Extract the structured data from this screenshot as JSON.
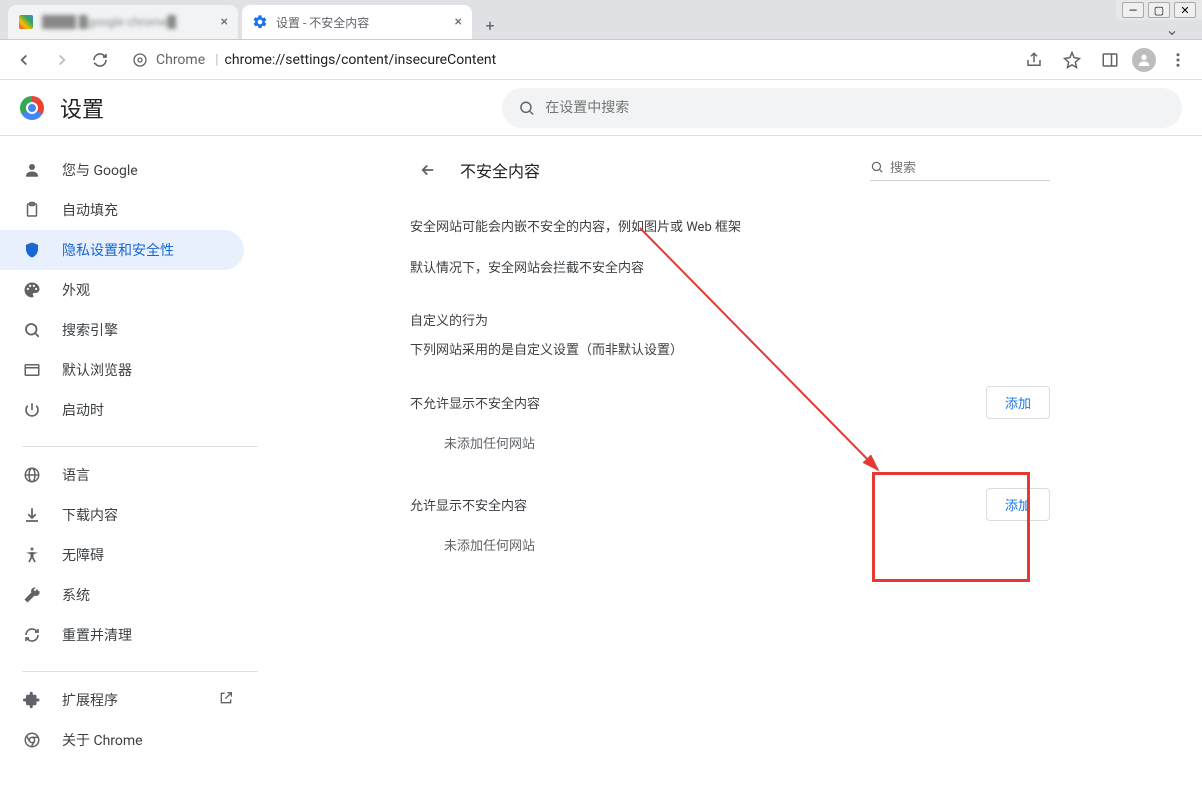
{
  "window": {
    "title_bar_inactive_tab": "████ █google chrome█"
  },
  "tabs": {
    "inactive": {
      "title": "████ █google chrome█"
    },
    "active": {
      "title": "设置 - 不安全内容"
    }
  },
  "toolbar": {
    "chrome_label": "Chrome",
    "url": "chrome://settings/content/insecureContent"
  },
  "settings_header": {
    "title": "设置",
    "search_placeholder": "在设置中搜索"
  },
  "sidebar": {
    "group1": [
      {
        "icon": "person",
        "label": "您与 Google"
      },
      {
        "icon": "clipboard",
        "label": "自动填充"
      },
      {
        "icon": "shield",
        "label": "隐私设置和安全性",
        "active": true
      },
      {
        "icon": "palette",
        "label": "外观"
      },
      {
        "icon": "search",
        "label": "搜索引擎"
      },
      {
        "icon": "browser",
        "label": "默认浏览器"
      },
      {
        "icon": "power",
        "label": "启动时"
      }
    ],
    "group2": [
      {
        "icon": "globe",
        "label": "语言"
      },
      {
        "icon": "download",
        "label": "下载内容"
      },
      {
        "icon": "accessibility",
        "label": "无障碍"
      },
      {
        "icon": "wrench",
        "label": "系统"
      },
      {
        "icon": "refresh",
        "label": "重置并清理"
      }
    ],
    "group3": [
      {
        "icon": "extension",
        "label": "扩展程序",
        "trailing": "open-in-new"
      },
      {
        "icon": "chrome",
        "label": "关于 Chrome"
      }
    ]
  },
  "panel": {
    "title": "不安全内容",
    "search_placeholder": "搜索",
    "desc1": "安全网站可能会内嵌不安全的内容，例如图片或 Web 框架",
    "desc2": "默认情况下，安全网站会拦截不安全内容",
    "custom_heading": "自定义的行为",
    "custom_sub": "下列网站采用的是自定义设置（而非默认设置）",
    "block_section": "不允许显示不安全内容",
    "allow_section": "允许显示不安全内容",
    "empty_text": "未添加任何网站",
    "add_button": "添加"
  }
}
